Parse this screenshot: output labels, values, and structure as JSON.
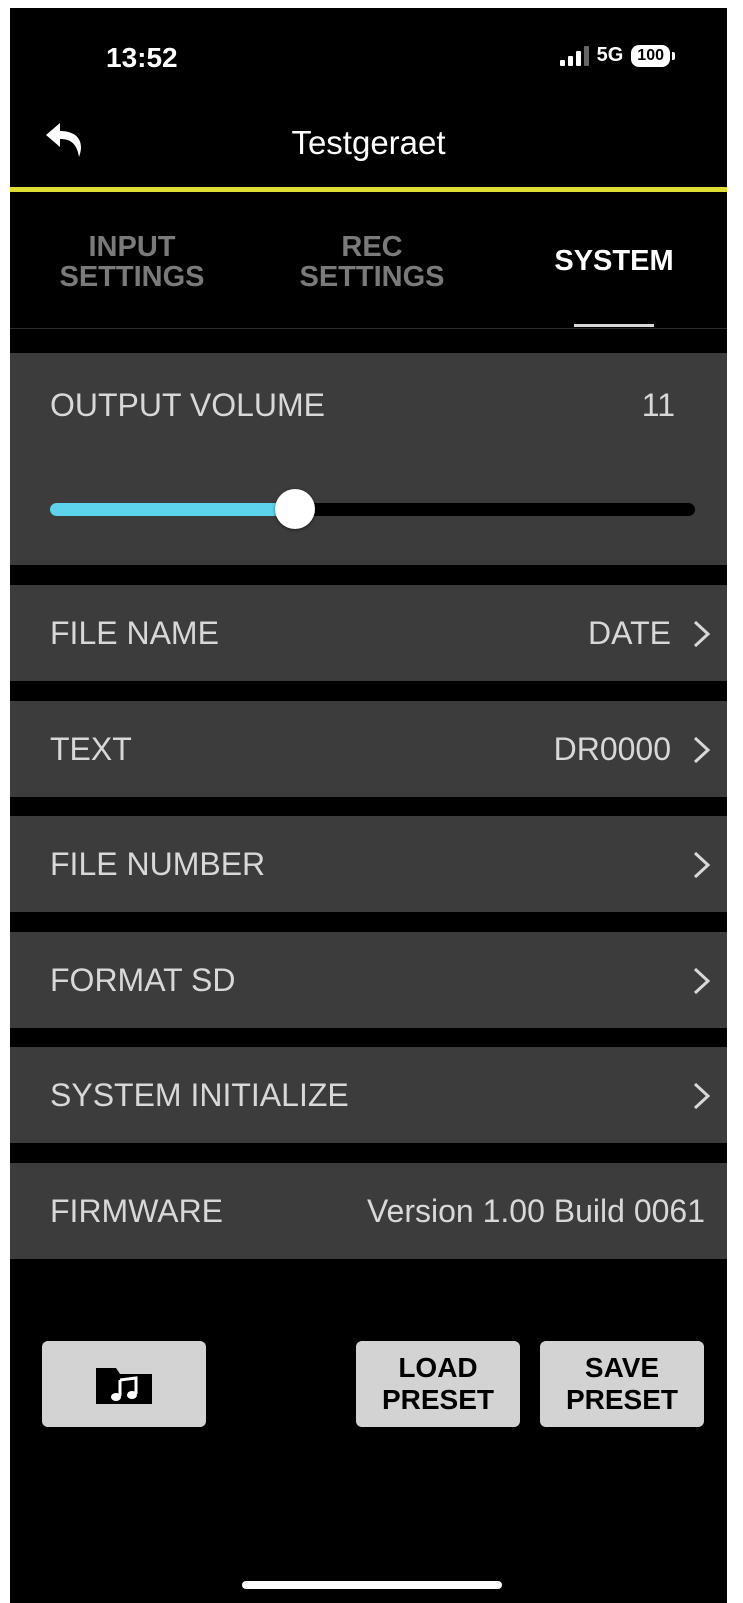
{
  "status_bar": {
    "time": "13:52",
    "network": "5G",
    "battery": "100"
  },
  "header": {
    "title": "Testgeraet",
    "back_icon": "back-arrow-icon",
    "accent_color": "#dddd33"
  },
  "tabs": [
    {
      "label": "INPUT\nSETTINGS",
      "active": false
    },
    {
      "label": "REC\nSETTINGS",
      "active": false
    },
    {
      "label": "SYSTEM",
      "active": true
    }
  ],
  "output_volume": {
    "label": "OUTPUT VOLUME",
    "value": "11",
    "slider_fraction": 0.38,
    "slider_color": "#5dd3ec"
  },
  "rows": [
    {
      "label": "FILE NAME",
      "value": "DATE",
      "chevron": true
    },
    {
      "label": "TEXT",
      "value": "DR0000",
      "chevron": true
    },
    {
      "label": "FILE NUMBER",
      "value": "",
      "chevron": true
    },
    {
      "label": "FORMAT SD",
      "value": "",
      "chevron": true
    },
    {
      "label": "SYSTEM INITIALIZE",
      "value": "",
      "chevron": true
    },
    {
      "label": "FIRMWARE",
      "value": "Version 1.00 Build 0061",
      "chevron": false
    }
  ],
  "buttons": {
    "folder_icon": "music-folder-icon",
    "load_preset": "LOAD\nPRESET",
    "save_preset": "SAVE\nPRESET"
  }
}
